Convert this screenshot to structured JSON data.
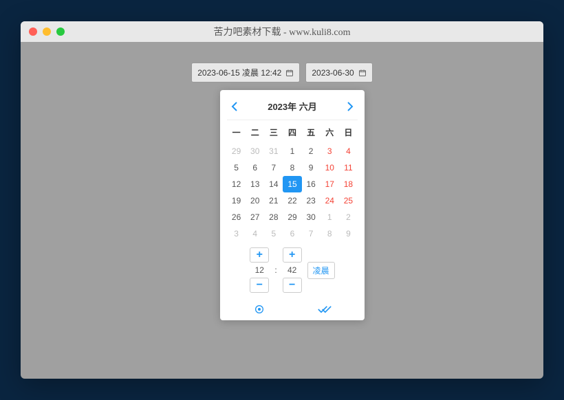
{
  "window": {
    "title": "苦力吧素材下载 - www.kuli8.com"
  },
  "inputs": {
    "start": "2023-06-15 凌晨 12:42",
    "end": "2023-06-30"
  },
  "calendar": {
    "month_label": "2023年 六月",
    "weekdays": [
      "一",
      "二",
      "三",
      "四",
      "五",
      "六",
      "日"
    ],
    "weeks": [
      [
        {
          "d": 29,
          "other": true
        },
        {
          "d": 30,
          "other": true
        },
        {
          "d": 31,
          "other": true
        },
        {
          "d": 1
        },
        {
          "d": 2
        },
        {
          "d": 3,
          "weekend": true
        },
        {
          "d": 4,
          "weekend": true
        }
      ],
      [
        {
          "d": 5
        },
        {
          "d": 6
        },
        {
          "d": 7
        },
        {
          "d": 8
        },
        {
          "d": 9
        },
        {
          "d": 10,
          "weekend": true
        },
        {
          "d": 11,
          "weekend": true
        }
      ],
      [
        {
          "d": 12
        },
        {
          "d": 13
        },
        {
          "d": 14
        },
        {
          "d": 15,
          "selected": true
        },
        {
          "d": 16
        },
        {
          "d": 17,
          "weekend": true
        },
        {
          "d": 18,
          "weekend": true
        }
      ],
      [
        {
          "d": 19
        },
        {
          "d": 20
        },
        {
          "d": 21
        },
        {
          "d": 22
        },
        {
          "d": 23
        },
        {
          "d": 24,
          "weekend": true
        },
        {
          "d": 25,
          "weekend": true
        }
      ],
      [
        {
          "d": 26
        },
        {
          "d": 27
        },
        {
          "d": 28
        },
        {
          "d": 29
        },
        {
          "d": 30
        },
        {
          "d": 1,
          "other": true
        },
        {
          "d": 2,
          "other": true
        }
      ],
      [
        {
          "d": 3,
          "other": true
        },
        {
          "d": 4,
          "other": true
        },
        {
          "d": 5,
          "other": true
        },
        {
          "d": 6,
          "other": true
        },
        {
          "d": 7,
          "other": true
        },
        {
          "d": 8,
          "other": true
        },
        {
          "d": 9,
          "other": true
        }
      ]
    ]
  },
  "time": {
    "hour": "12",
    "minute": "42",
    "separator": ":",
    "ampm": "凌晨",
    "plus": "+",
    "minus": "−"
  }
}
